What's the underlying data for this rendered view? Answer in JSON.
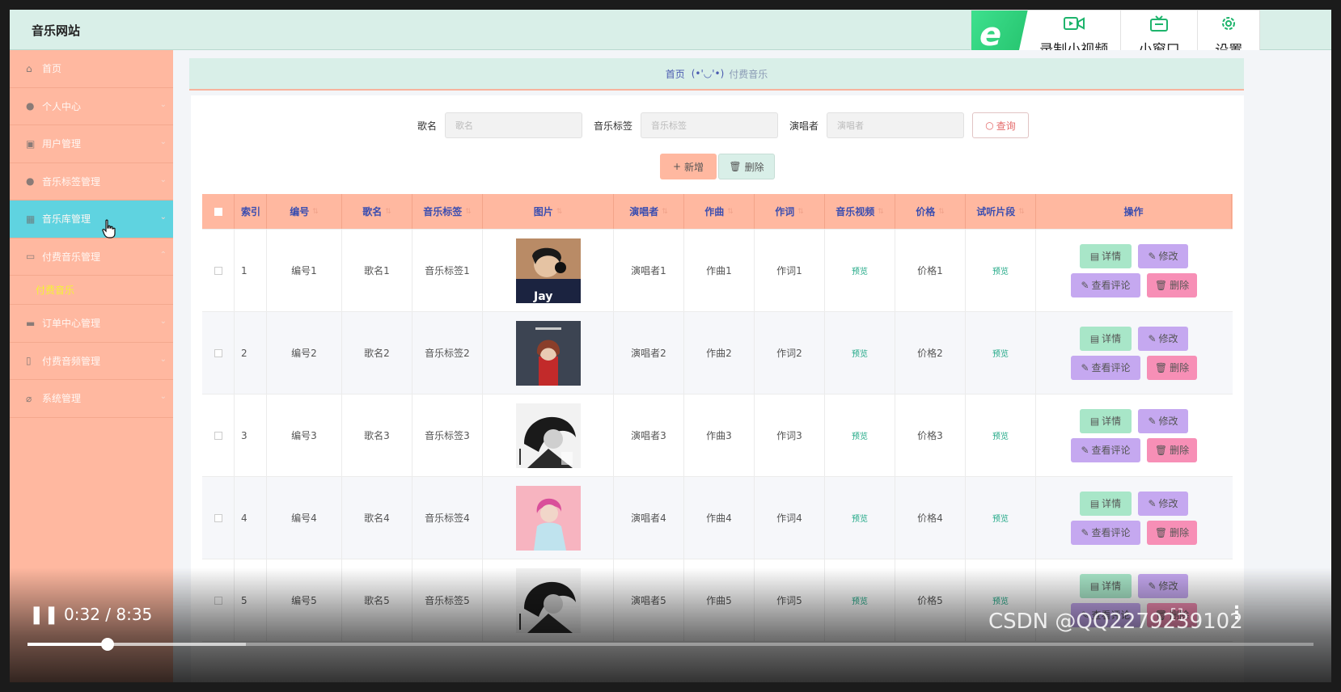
{
  "header": {
    "site_title": "音乐网站"
  },
  "browser_toolbar": {
    "logo_letter": "e",
    "record_label": "录制小视频",
    "mini_label": "小窗口",
    "settings_label": "设置"
  },
  "sidebar": {
    "items": [
      {
        "label": "首页",
        "icon": "home-icon",
        "chevron": ""
      },
      {
        "label": "个人中心",
        "icon": "user-icon",
        "chevron": "⌄"
      },
      {
        "label": "用户管理",
        "icon": "users-icon",
        "chevron": "⌄"
      },
      {
        "label": "音乐标签管理",
        "icon": "user-tag-icon",
        "chevron": "⌄"
      },
      {
        "label": "音乐库管理",
        "icon": "grid-icon",
        "chevron": "⌄"
      },
      {
        "label": "付费音乐管理",
        "icon": "pay-icon",
        "chevron": "⌃"
      },
      {
        "label": "订单中心管理",
        "icon": "order-icon",
        "chevron": "⌄"
      },
      {
        "label": "付费音频管理",
        "icon": "audio-icon",
        "chevron": "⌄"
      },
      {
        "label": "系统管理",
        "icon": "settings-icon",
        "chevron": "⌄"
      }
    ],
    "sub_item": "付费音乐"
  },
  "breadcrumb": {
    "home": "首页",
    "emoji": "(•'◡'•)",
    "current": "付费音乐"
  },
  "search": {
    "song_label": "歌名",
    "song_placeholder": "歌名",
    "tag_label": "音乐标签",
    "tag_placeholder": "音乐标签",
    "singer_label": "演唱者",
    "singer_placeholder": "演唱者",
    "query_label": "查询"
  },
  "actions": {
    "add_label": "新增",
    "delete_label": "删除"
  },
  "table": {
    "headers": [
      "索引",
      "编号",
      "歌名",
      "音乐标签",
      "图片",
      "演唱者",
      "作曲",
      "作词",
      "音乐视频",
      "价格",
      "试听片段",
      "操作"
    ],
    "rows": [
      {
        "index": "1",
        "number": "编号1",
        "name": "歌名1",
        "tag": "音乐标签1",
        "singer": "演唱者1",
        "composer": "作曲1",
        "lyricist": "作词1",
        "video": "预览",
        "price": "价格1",
        "trial": "预览"
      },
      {
        "index": "2",
        "number": "编号2",
        "name": "歌名2",
        "tag": "音乐标签2",
        "singer": "演唱者2",
        "composer": "作曲2",
        "lyricist": "作词2",
        "video": "预览",
        "price": "价格2",
        "trial": "预览"
      },
      {
        "index": "3",
        "number": "编号3",
        "name": "歌名3",
        "tag": "音乐标签3",
        "singer": "演唱者3",
        "composer": "作曲3",
        "lyricist": "作词3",
        "video": "预览",
        "price": "价格3",
        "trial": "预览"
      },
      {
        "index": "4",
        "number": "编号4",
        "name": "歌名4",
        "tag": "音乐标签4",
        "singer": "演唱者4",
        "composer": "作曲4",
        "lyricist": "作词4",
        "video": "预览",
        "price": "价格4",
        "trial": "预览"
      },
      {
        "index": "5",
        "number": "编号5",
        "name": "歌名5",
        "tag": "音乐标签5",
        "singer": "演唱者5",
        "composer": "作曲5",
        "lyricist": "作词5",
        "video": "预览",
        "price": "价格5",
        "trial": "预览"
      }
    ],
    "ops": {
      "detail": "详情",
      "edit": "修改",
      "comment": "查看评论",
      "delete": "删除"
    },
    "cover_text": {
      "jay": "Jay"
    }
  },
  "video": {
    "time": "0:32 / 8:35",
    "progress": 0.062,
    "buffered": 0.17,
    "watermark": "CSDN @QQ2279239102"
  },
  "colors": {
    "sidebar_bg": "#ffb8a0",
    "active_item": "#5fd3e0",
    "header_bg": "#d9efe8",
    "detail_btn": "#a8e6c8",
    "edit_btn": "#c5a8f0",
    "delete_btn": "#f78fb6"
  }
}
